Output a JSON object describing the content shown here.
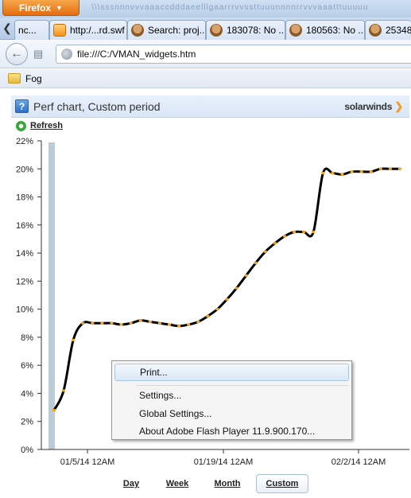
{
  "browser": {
    "app_button": "Firefox",
    "title_noise": "\\\\\\sssnnnvvvaaaccdddaeelllgaarrrvvssttuuunnnnrrvvvaaatttuuuuu",
    "tabs": [
      {
        "label": "nc..."
      },
      {
        "label": "http:/...rd.swf"
      },
      {
        "label": "Search: proj..."
      },
      {
        "label": "183078: No ..."
      },
      {
        "label": "180563: No ..."
      },
      {
        "label": "253487..."
      }
    ],
    "url": "file:///C:/VMAN_widgets.htm",
    "bookmarks": [
      {
        "label": "Fog"
      }
    ]
  },
  "widget": {
    "title": "Perf chart, Custom period",
    "logo": "solarwinds",
    "refresh_label": "Refresh",
    "zoom_buttons": [
      {
        "label": "Day"
      },
      {
        "label": "Week"
      },
      {
        "label": "Month"
      },
      {
        "label": "Custom",
        "active": true
      }
    ]
  },
  "context_menu": {
    "items": [
      "Print...",
      "Settings...",
      "Global Settings...",
      "About Adobe Flash Player 11.9.900.170..."
    ]
  },
  "chart_data": {
    "type": "line",
    "x_tick_labels": [
      "01/5/14 12AM",
      "01/19/14 12AM",
      "02/2/14 12AM"
    ],
    "y_tick_labels": [
      "0%",
      "2%",
      "4%",
      "6%",
      "8%",
      "10%",
      "12%",
      "14%",
      "16%",
      "18%",
      "20%",
      "22%"
    ],
    "ylim": [
      0,
      22
    ],
    "grid": false,
    "legend": "none",
    "line_color": "#000000",
    "marker_color": "#f5a623",
    "series": [
      {
        "x_day_index": [
          0,
          1,
          2,
          3,
          4,
          5,
          6,
          7,
          8,
          9,
          10,
          11,
          12,
          13,
          14,
          15,
          16,
          17,
          18,
          19,
          20,
          21,
          22,
          23,
          24,
          25,
          26,
          27,
          28,
          29,
          30,
          31,
          32,
          33,
          34,
          35,
          36
        ],
        "values": [
          2.8,
          4.2,
          7.8,
          9.0,
          9.0,
          9.0,
          9.0,
          8.9,
          9.0,
          9.2,
          9.1,
          9.0,
          8.9,
          8.8,
          8.9,
          9.1,
          9.5,
          10.0,
          10.7,
          11.5,
          12.4,
          13.3,
          14.1,
          14.7,
          15.2,
          15.5,
          15.5,
          15.5,
          19.7,
          19.7,
          19.6,
          19.8,
          19.8,
          19.8,
          20.0,
          20.0,
          20.0
        ]
      }
    ]
  }
}
